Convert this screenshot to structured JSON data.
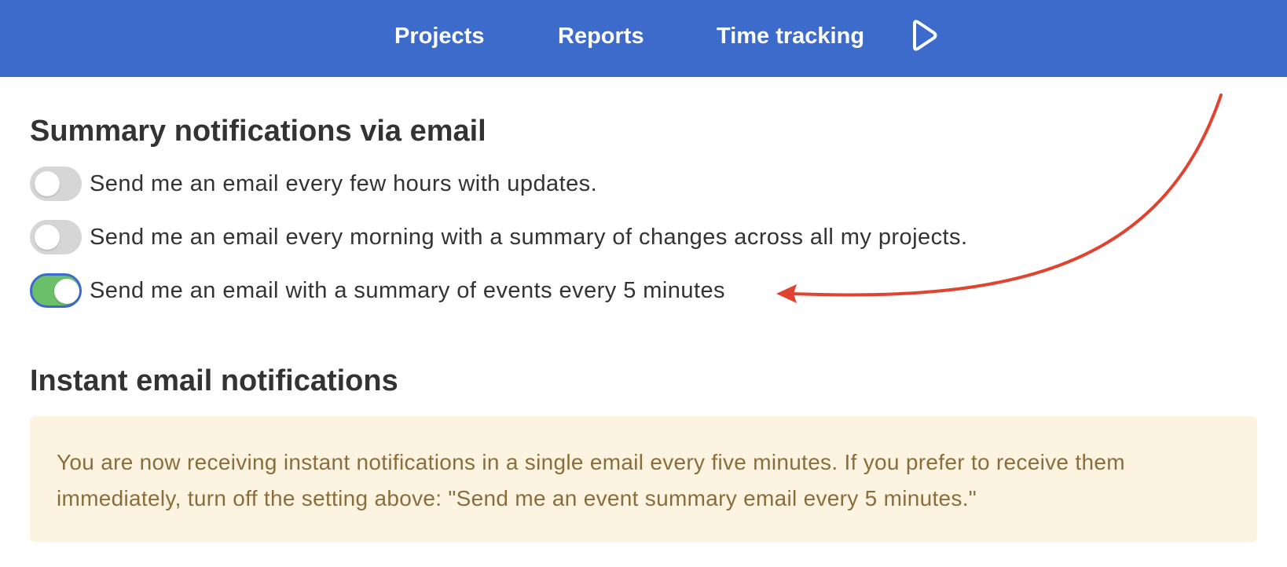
{
  "nav": {
    "projects": "Projects",
    "reports": "Reports",
    "time_tracking": "Time tracking",
    "play_icon": "play-icon"
  },
  "summary": {
    "title": "Summary notifications via email",
    "settings": [
      {
        "label": "Send me an email every few hours with updates.",
        "enabled": false
      },
      {
        "label": "Send me an email every morning with a summary of changes across all my projects.",
        "enabled": false
      },
      {
        "label": "Send me an email with a summary of events every 5 minutes",
        "enabled": true
      }
    ]
  },
  "instant": {
    "title": "Instant email notifications",
    "notice": "You are now receiving instant notifications in a single email every five minutes. If you prefer to receive them immediately, turn off the setting above: \"Send me an event summary email every 5 minutes.\""
  },
  "colors": {
    "nav_bg": "#3d6bcb",
    "toggle_on": "#6bbf6a",
    "toggle_off": "#d6d6d6",
    "arrow": "#e0432f",
    "notice_bg": "#fcf4e1",
    "notice_text": "#8a6d3b"
  }
}
